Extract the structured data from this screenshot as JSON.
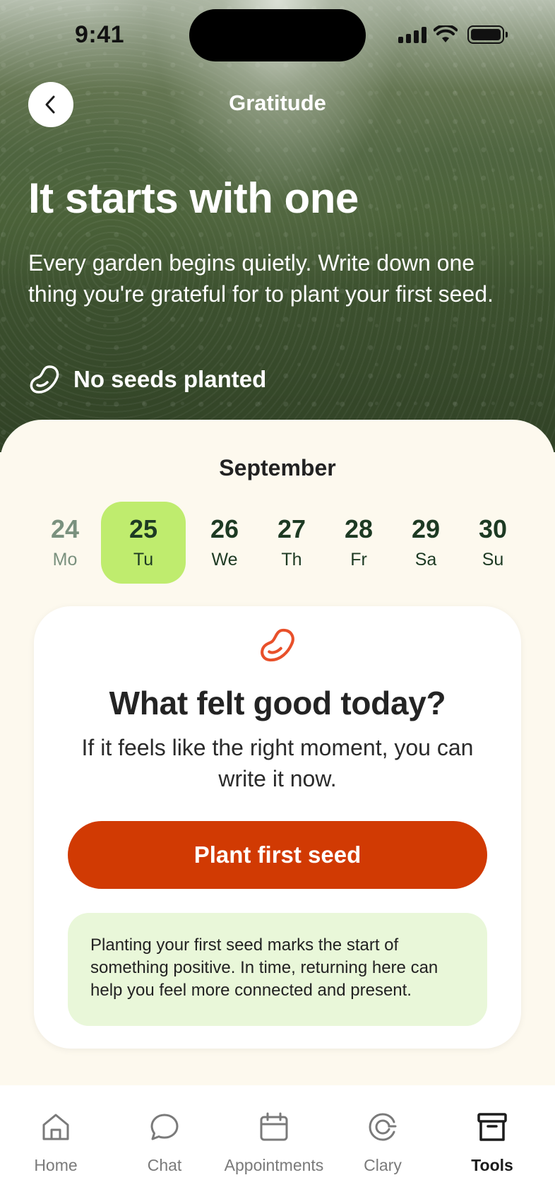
{
  "status_bar": {
    "time": "9:41"
  },
  "header": {
    "title": "Gratitude"
  },
  "hero": {
    "heading": "It starts with one",
    "body": "Every garden begins quietly. Write down one thing you're grateful for to plant your first seed.",
    "seed_status": "No seeds planted"
  },
  "calendar": {
    "month": "September",
    "days": [
      {
        "num": "24",
        "weekday": "Mo",
        "state": "past"
      },
      {
        "num": "25",
        "weekday": "Tu",
        "state": "selected"
      },
      {
        "num": "26",
        "weekday": "We",
        "state": "upcoming"
      },
      {
        "num": "27",
        "weekday": "Th",
        "state": "upcoming"
      },
      {
        "num": "28",
        "weekday": "Fr",
        "state": "upcoming"
      },
      {
        "num": "29",
        "weekday": "Sa",
        "state": "upcoming"
      },
      {
        "num": "30",
        "weekday": "Su",
        "state": "upcoming"
      }
    ]
  },
  "card": {
    "icon": "seed-icon",
    "title": "What felt good today?",
    "subtitle": "If it feels like the right moment, you can write it now.",
    "button_label": "Plant first seed",
    "info_text": "Planting your first seed marks the start of something positive. In time, returning here can help you feel more connected and present."
  },
  "tab_bar": {
    "items": [
      {
        "label": "Home",
        "icon": "home-icon",
        "active": false
      },
      {
        "label": "Chat",
        "icon": "chat-icon",
        "active": false
      },
      {
        "label": "Appointments",
        "icon": "calendar-icon",
        "active": false
      },
      {
        "label": "Clary",
        "icon": "clary-icon",
        "active": false
      },
      {
        "label": "Tools",
        "icon": "archive-icon",
        "active": true
      }
    ]
  },
  "colors": {
    "accent": "#d13a03",
    "selected_day": "#bfec6e",
    "info_bg": "#e9f7d9",
    "sheet_bg": "#fdf9ee",
    "dark_green_text": "#1d3a23"
  }
}
